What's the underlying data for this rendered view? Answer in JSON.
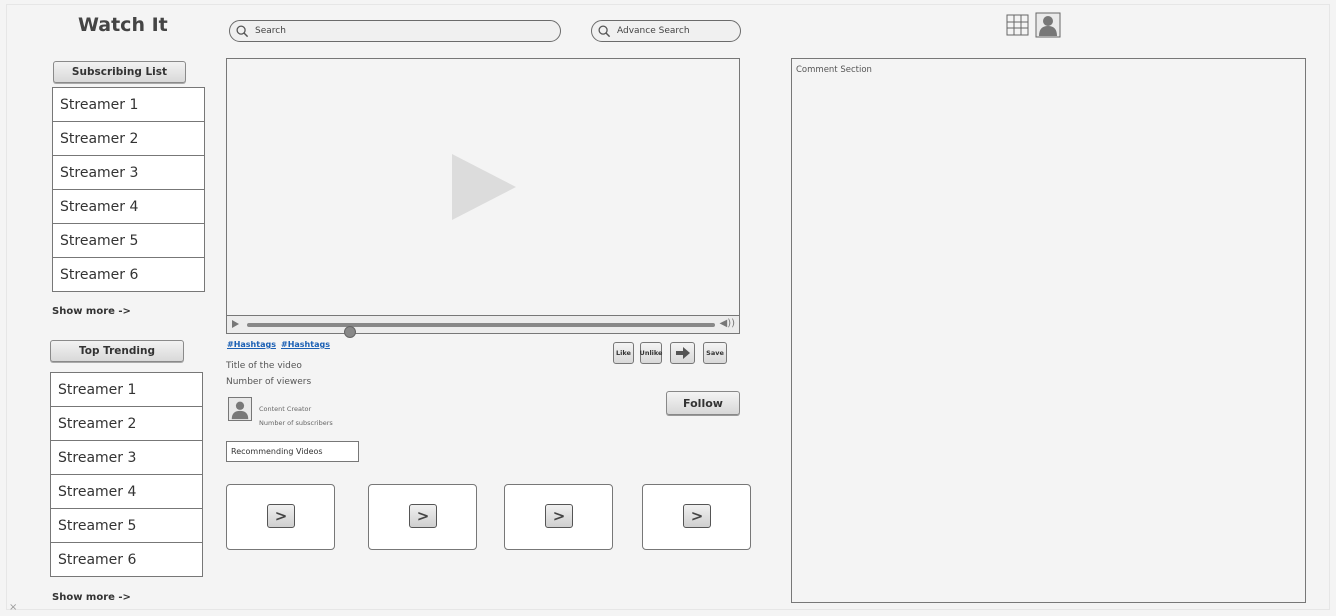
{
  "app": {
    "title": "Watch It"
  },
  "search": {
    "placeholder": "Search"
  },
  "advance_search": {
    "placeholder": "Advance Search"
  },
  "header_icons": [
    "grid-icon",
    "user-profile-icon"
  ],
  "subscribing": {
    "label": "Subscribing List",
    "items": [
      "Streamer 1",
      "Streamer 2",
      "Streamer 3",
      "Streamer 4",
      "Streamer 5",
      "Streamer 6"
    ],
    "show_more": "Show more ->"
  },
  "trending": {
    "label": "Top Trending",
    "items": [
      "Streamer 1",
      "Streamer 2",
      "Streamer 3",
      "Streamer 4",
      "Streamer 5",
      "Streamer 6"
    ],
    "show_more": "Show more ->"
  },
  "video": {
    "hashtags": [
      "#Hashtags",
      "#Hashtags"
    ],
    "title": "Title of the video",
    "viewers": "Number of viewers",
    "creator": "Content Creator",
    "subscribers": "Number of subscribers",
    "progress": 0.22
  },
  "actions": {
    "like": "Like",
    "unlike": "Unlike",
    "save": "Save",
    "follow": "Follow"
  },
  "recommending": {
    "label": "Recommending Videos",
    "thumb_glyph": ">"
  },
  "comments": {
    "label": "Comment Section"
  }
}
